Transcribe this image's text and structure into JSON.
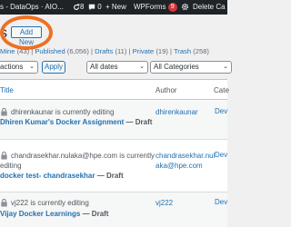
{
  "admin_bar": {
    "site_label": "s - DataOps · AIO...",
    "updates_count": "8",
    "comments_count": "0",
    "new_label": "New",
    "wpforms_label": "WPForms",
    "wpforms_badge": "9",
    "delete_label": "Delete Ca"
  },
  "page": {
    "heading_fragment": "s",
    "add_new_label": "Add New"
  },
  "status_filters": {
    "mine_label": "Mine",
    "mine_count": "(43)",
    "published_label": "Published",
    "published_count": "(6,056)",
    "drafts_label": "Drafts",
    "drafts_count": "(11)",
    "private_label": "Private",
    "private_count": "(19)",
    "trash_label": "Trash",
    "trash_count": "(258)"
  },
  "filters": {
    "bulk_actions": "actions",
    "apply_label": "Apply",
    "dates_label": "All dates",
    "categories_label": "All Categories"
  },
  "table": {
    "col_title": "Title",
    "col_author": "Author",
    "col_categories": "Cate",
    "rows": [
      {
        "editing_text": "dhirenkaunar is currently editing",
        "title": "Dhiren Kumar's Docker Assignment",
        "state": "— Draft",
        "author_line1": "dhirenkaunar",
        "author_line2": "",
        "category": "Dev"
      },
      {
        "editing_text_line1": "chandrasekhar.nulaka@hpe.com is currently",
        "editing_text_line2": "editing",
        "title": "docker test- chandrasekhar",
        "state": "— Draft",
        "author_line1": "chandrasekhar.nul",
        "author_line2": "aka@hpe.com",
        "category": "Dev"
      },
      {
        "editing_text": "vj222 is currently editing",
        "title": "Vijay Docker Learnings",
        "state": "— Draft",
        "author_line1": "vj222",
        "author_line2": "",
        "category": "Dev"
      }
    ]
  },
  "colors": {
    "admin_bar_bg": "#1d2327",
    "link_blue": "#2271b1",
    "badge_red": "#d63638",
    "highlight_orange": "#f07022"
  }
}
